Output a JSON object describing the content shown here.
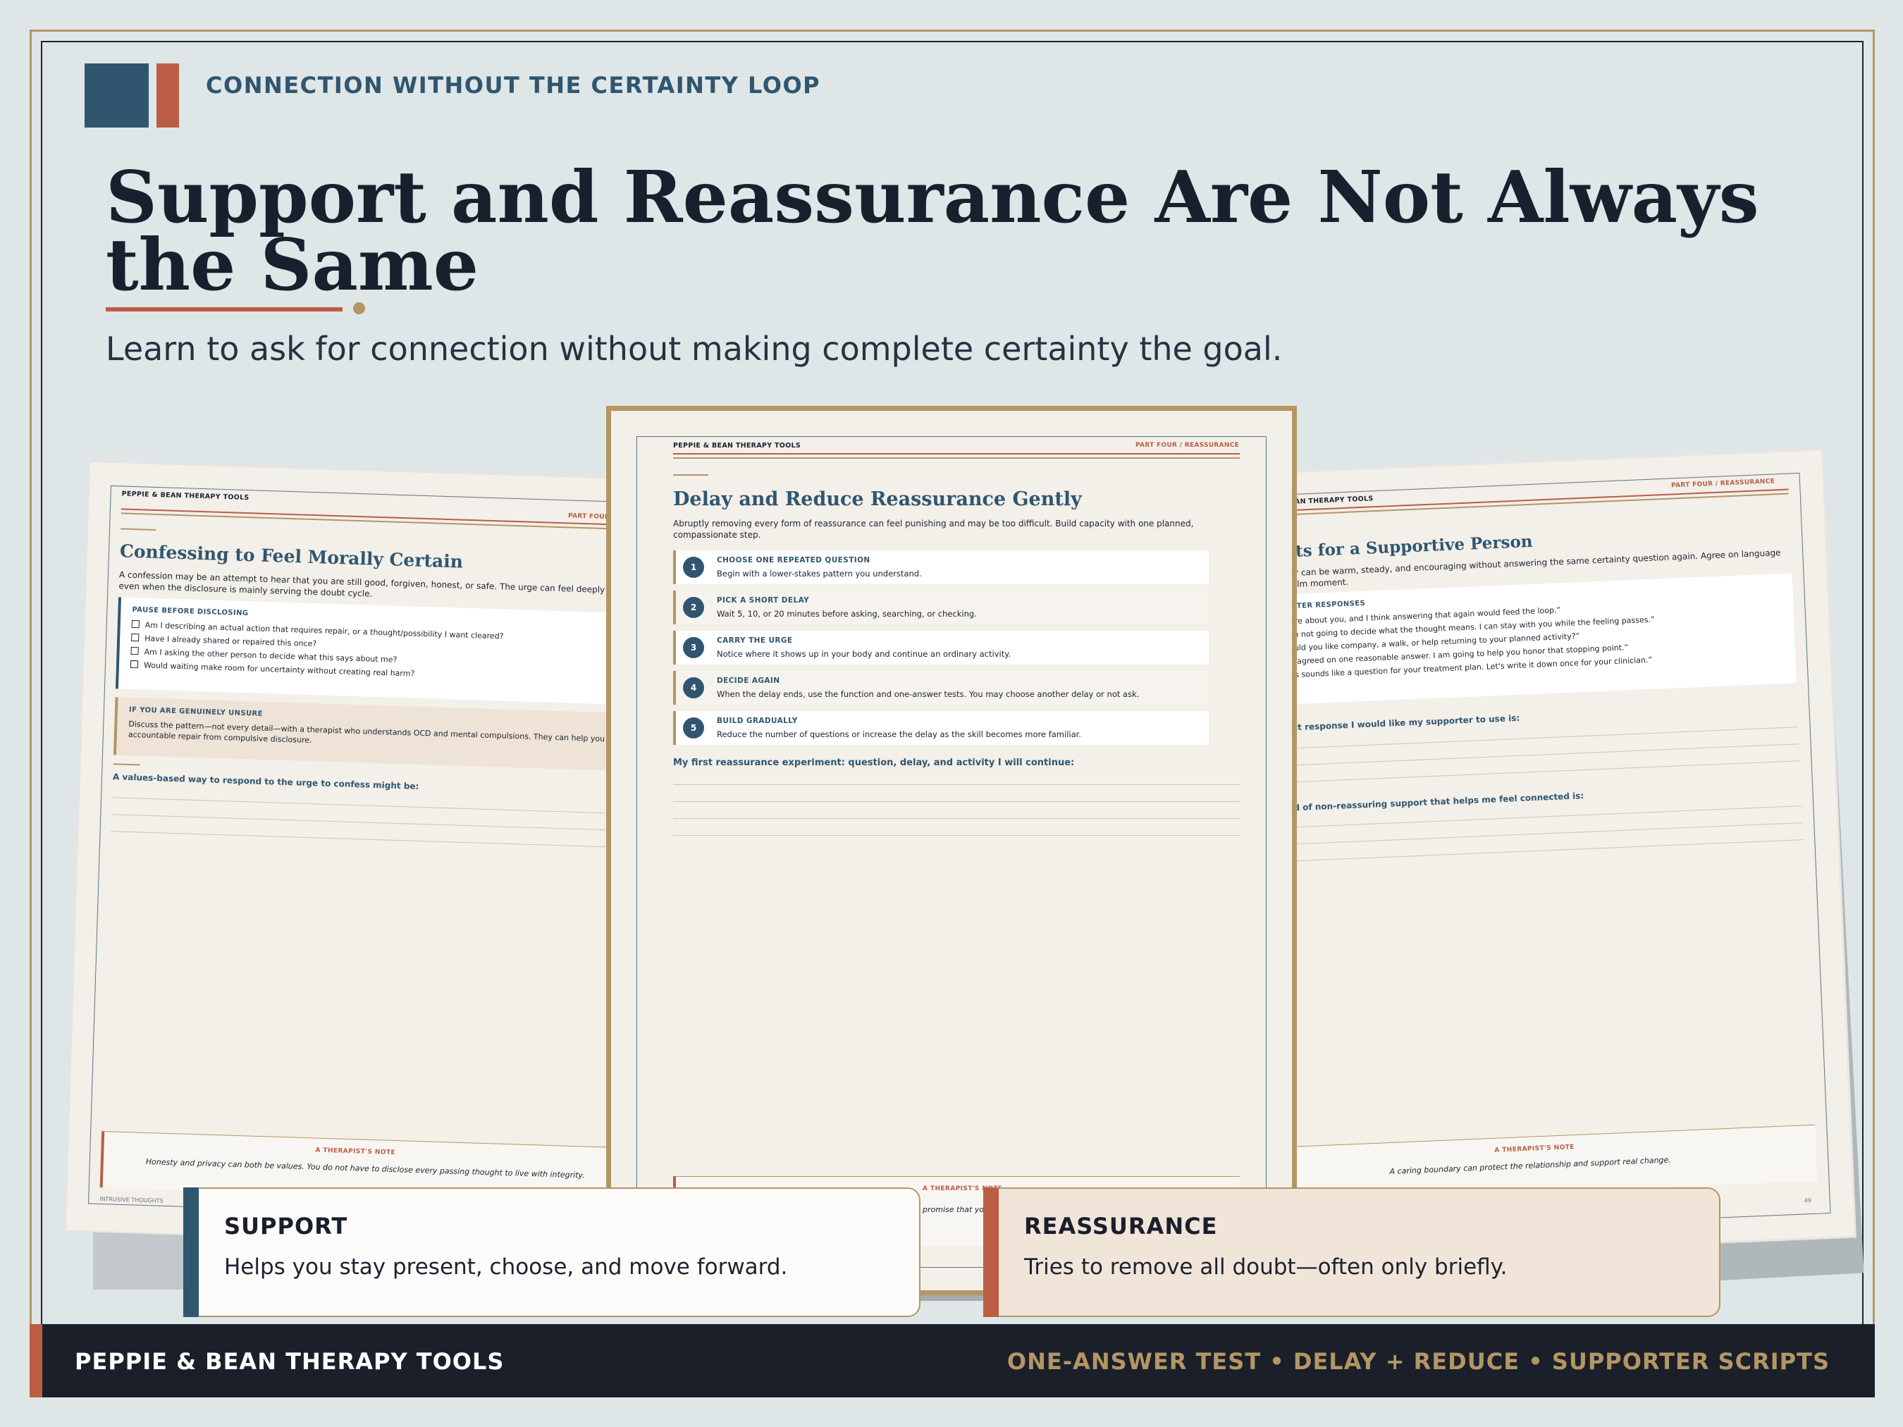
{
  "colors": {
    "navy": "#30566f",
    "rust": "#bb5d45",
    "gold": "#b39664",
    "ink": "#1a1f2d",
    "background": "#dfe6e8",
    "paper": "#f3efe9"
  },
  "header": {
    "eyebrow": "CONNECTION WITHOUT THE CERTAINTY LOOP",
    "title": "Support and Reassurance Are Not Always the Same",
    "subtitle": "Learn to ask for connection without making complete certainty the goal."
  },
  "sheet_left": {
    "brand": "PEPPIE & BEAN THERAPY TOOLS",
    "part": "PART FOUR",
    "title": "Confessing to Feel Morally Certain",
    "intro": "A confession may be an attempt to hear that you are still good, forgiven, honest, or safe. The urge can feel deeply moral even when the disclosure is mainly serving the doubt cycle.",
    "panel_title": "PAUSE BEFORE DISCLOSING",
    "checks": [
      "Am I describing an actual action that requires repair, or a thought/possibility I want cleared?",
      "Have I already shared or repaired this once?",
      "Am I asking the other person to decide what this says about me?",
      "Would waiting make room for uncertainty without creating real harm?"
    ],
    "tan_title": "IF YOU ARE GENUINELY UNSURE",
    "tan_text": "Discuss the pattern—not every detail—with a therapist who understands OCD and mental compulsions. They can help you separate accountable repair from compulsive disclosure.",
    "prompt": "A values-based way to respond to the urge to confess might be:",
    "note_label": "A THERAPIST'S NOTE",
    "note_text": "Honesty and privacy can both be values. You do not have to disclose every passing thought to live with integrity.",
    "footer": "INTRUSIVE THOUGHTS"
  },
  "sheet_mid": {
    "brand": "PEPPIE & BEAN THERAPY TOOLS",
    "part": "PART FOUR / REASSURANCE",
    "title": "Delay and Reduce Reassurance Gently",
    "intro": "Abruptly removing every form of reassurance can feel punishing and may be too difficult. Build capacity with one planned, compassionate step.",
    "steps": [
      {
        "num": "1",
        "title": "CHOOSE ONE REPEATED QUESTION",
        "desc": "Begin with a lower-stakes pattern you understand."
      },
      {
        "num": "2",
        "title": "PICK A SHORT DELAY",
        "desc": "Wait 5, 10, or 20 minutes before asking, searching, or checking."
      },
      {
        "num": "3",
        "title": "CARRY THE URGE",
        "desc": "Notice where it shows up in your body and continue an ordinary activity."
      },
      {
        "num": "4",
        "title": "DECIDE AGAIN",
        "desc": "When the delay ends, use the function and one-answer tests. You may choose another delay or not ask."
      },
      {
        "num": "5",
        "title": "BUILD GRADUALLY",
        "desc": "Reduce the number of questions or increase the delay as the skill becomes more familiar."
      }
    ],
    "prompt": "My first reassurance experiment: question, delay, and activity I will continue:",
    "note_label": "A THERAPIST'S NOTE",
    "note_text": "promise that yo"
  },
  "sheet_right": {
    "brand": "PEPPIE & BEAN THERAPY TOOLS",
    "part": "PART FOUR / REASSURANCE",
    "title": "Scripts for a Supportive Person",
    "intro": "A supporter can be warm, steady, and encouraging without answering the same certainty question again. Agree on language during a calm moment.",
    "panel_title": "SUPPORTER RESPONSES",
    "checks": [
      "“I care about you, and I think answering that again would feed the loop.”",
      "“I am not going to decide what the thought means. I can stay with you while the feeling passes.”",
      "“Would you like company, a walk, or help returning to your planned activity?”",
      "“We agreed on one reasonable answer. I am going to help you honor that stopping point.”",
      "“This sounds like a question for your treatment plan. Let's write it down once for your clinician.”"
    ],
    "prompt1": "The exact response I would like my supporter to use is:",
    "prompt2": "The kind of non-reassuring support that helps me feel connected is:",
    "note_label": "A THERAPIST'S NOTE",
    "note_text": "A caring boundary can protect the relationship and support real change.",
    "page_number": "49"
  },
  "cards": {
    "support": {
      "title": "SUPPORT",
      "desc": "Helps you stay present, choose, and move forward."
    },
    "reassurance": {
      "title": "REASSURANCE",
      "desc": "Tries to remove all doubt—often only briefly."
    }
  },
  "footer": {
    "left": "PEPPIE & BEAN THERAPY TOOLS",
    "right": "ONE-ANSWER TEST • DELAY + REDUCE • SUPPORTER SCRIPTS"
  }
}
